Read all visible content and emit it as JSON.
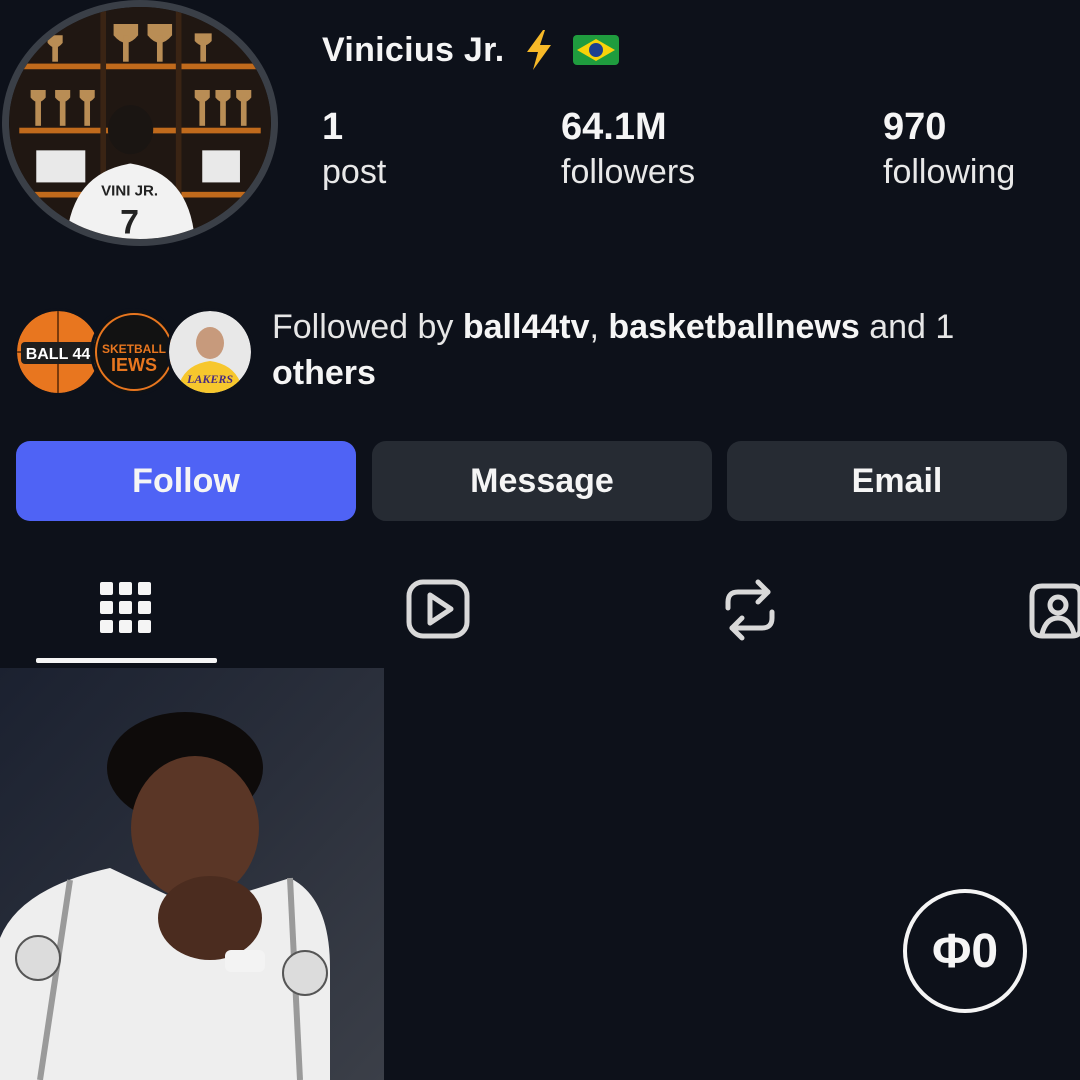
{
  "profile": {
    "name": "Vinicius Jr.",
    "badges": [
      "lightning-bolt-emoji",
      "brazil-flag-emoji"
    ],
    "avatar_jersey_text": "VINI JR."
  },
  "stats": [
    {
      "value": "1",
      "label": "post"
    },
    {
      "value": "64.1M",
      "label": "followers"
    },
    {
      "value": "970",
      "label": "following"
    }
  ],
  "followed_by": {
    "prefix": "Followed by ",
    "accounts": [
      "ball44tv",
      "basketballnews"
    ],
    "separator": ", ",
    "suffix_line1": " and 1",
    "suffix_line2": "others",
    "avatar_labels": {
      "ball44": "BALL 44",
      "basketballnews_top": "SKETBALL",
      "basketballnews_bottom": "IEWS",
      "lakers": "LAKERS"
    }
  },
  "actions": {
    "follow": "Follow",
    "message": "Message",
    "email": "Email"
  },
  "tabs": [
    {
      "icon": "grid-icon",
      "selected": true
    },
    {
      "icon": "reels-icon",
      "selected": false
    },
    {
      "icon": "reposts-icon",
      "selected": false
    },
    {
      "icon": "tagged-icon",
      "selected": false
    }
  ],
  "watermark": "Φ0",
  "colors": {
    "background": "#0d111a",
    "follow_button": "#4f63f5",
    "secondary_button": "#262b33",
    "text": "#f5f5f5"
  }
}
